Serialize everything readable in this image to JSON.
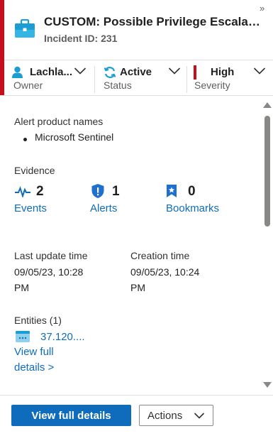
{
  "header": {
    "title": "CUSTOM: Possible Privilege Escalation",
    "incident_id": "Incident ID: 231",
    "collapse_glyph": "»"
  },
  "properties": {
    "owner": {
      "value": "Lachla...",
      "label": "Owner"
    },
    "status": {
      "value": "Active",
      "label": "Status"
    },
    "severity": {
      "value": "High",
      "label": "Severity"
    }
  },
  "details": {
    "alert_product_names_label": "Alert product names",
    "alert_product_names": [
      "Microsoft Sentinel"
    ],
    "evidence_label": "Evidence",
    "evidence": {
      "events": {
        "count": "2",
        "label": "Events"
      },
      "alerts": {
        "count": "1",
        "label": "Alerts"
      },
      "bookmarks": {
        "count": "0",
        "label": "Bookmarks"
      }
    },
    "last_update_label": "Last update time",
    "last_update_line1": "09/05/23, 10:28",
    "last_update_line2": "PM",
    "creation_label": "Creation time",
    "creation_line1": "09/05/23, 10:24",
    "creation_line2": "PM",
    "entities_label": "Entities (1)",
    "entity_ip": "37.120....",
    "view_full_line1": "View full",
    "view_full_line2": "details >"
  },
  "footer": {
    "primary_button": "View full details",
    "actions_button": "Actions"
  },
  "colors": {
    "accent_red": "#c50f1f",
    "link_blue": "#0f6cbd",
    "icon_teal": "#0078a8"
  }
}
